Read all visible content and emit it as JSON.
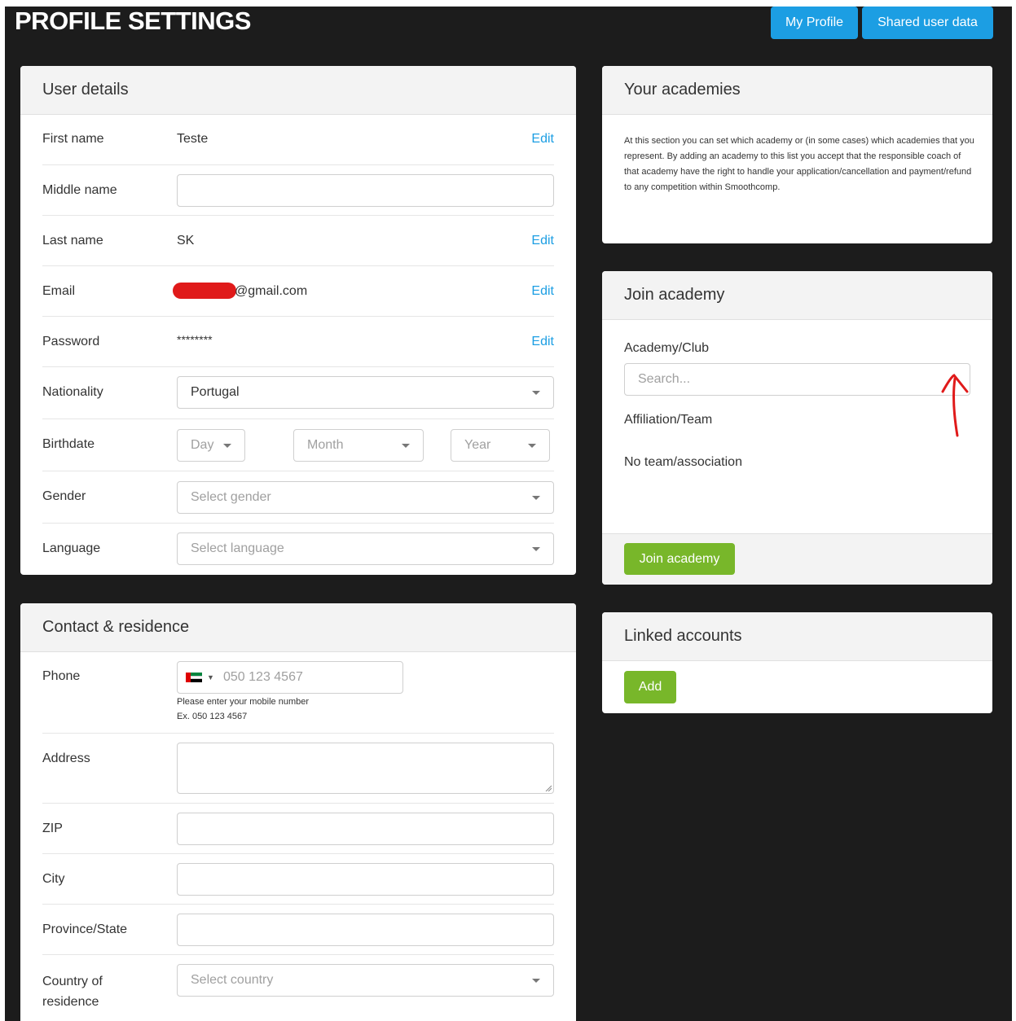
{
  "header": {
    "title": "PROFILE SETTINGS",
    "my_profile_label": "My Profile",
    "shared_data_label": "Shared user data"
  },
  "user_details": {
    "title": "User details",
    "edit_label": "Edit",
    "first_name": {
      "label": "First name",
      "value": "Teste"
    },
    "middle_name": {
      "label": "Middle name",
      "value": ""
    },
    "last_name": {
      "label": "Last name",
      "value": "SK"
    },
    "email": {
      "label": "Email",
      "value": "@gmail.com"
    },
    "password": {
      "label": "Password",
      "value": "********"
    },
    "nationality": {
      "label": "Nationality",
      "value": "Portugal"
    },
    "birthdate": {
      "label": "Birthdate",
      "day": "Day",
      "month": "Month",
      "year": "Year"
    },
    "gender": {
      "label": "Gender",
      "placeholder": "Select gender"
    },
    "language": {
      "label": "Language",
      "placeholder": "Select language"
    }
  },
  "contact": {
    "title": "Contact & residence",
    "phone": {
      "label": "Phone",
      "placeholder": "050 123 4567",
      "hint1": "Please enter your mobile number",
      "hint2": "Ex. 050 123 4567"
    },
    "address": {
      "label": "Address"
    },
    "zip": {
      "label": "ZIP"
    },
    "city": {
      "label": "City"
    },
    "province": {
      "label": "Province/State"
    },
    "country": {
      "label1": "Country of",
      "label2": "residence",
      "placeholder": "Select country"
    }
  },
  "academies": {
    "title": "Your academies",
    "description": "At this section you can set which academy or (in some cases) which academies that you represent. By adding an academy to this list you accept that the responsible coach of that academy have the right to handle your application/cancellation and payment/refund to any competition within Smoothcomp."
  },
  "join": {
    "title": "Join academy",
    "club_label": "Academy/Club",
    "search_placeholder": "Search...",
    "team_label": "Affiliation/Team",
    "team_value": "No team/association",
    "button_label": "Join academy"
  },
  "linked": {
    "title": "Linked accounts",
    "add_label": "Add"
  },
  "colors": {
    "primary": "#1c9ee3",
    "success": "#78b72a",
    "background": "#1c1c1c",
    "annotation": "#e01a1a"
  }
}
